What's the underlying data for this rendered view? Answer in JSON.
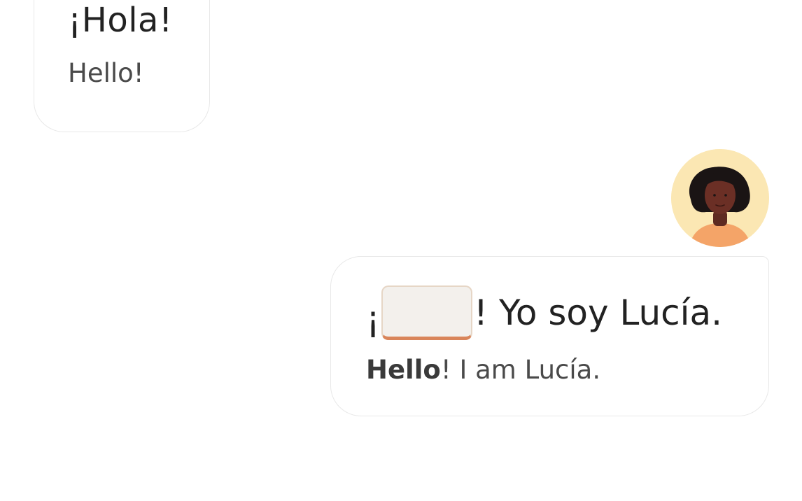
{
  "conversation": {
    "messages": [
      {
        "side": "left",
        "target_text": "¡Hola!",
        "translation": "Hello!"
      },
      {
        "side": "right",
        "speaker_avatar": "woman-avatar",
        "target_prefix": "¡",
        "blank": "",
        "target_suffix": "! Yo soy Lucía.",
        "translation_highlight": "Hello",
        "translation_rest": "! I am Lucía."
      }
    ]
  },
  "colors": {
    "bubble_border": "#e8e8e8",
    "blank_underline": "#d9855a",
    "avatar_background": "#fbe7b3",
    "avatar_shirt": "#f4a468",
    "avatar_skin": "#6b2f25",
    "avatar_hair": "#1a1414"
  }
}
